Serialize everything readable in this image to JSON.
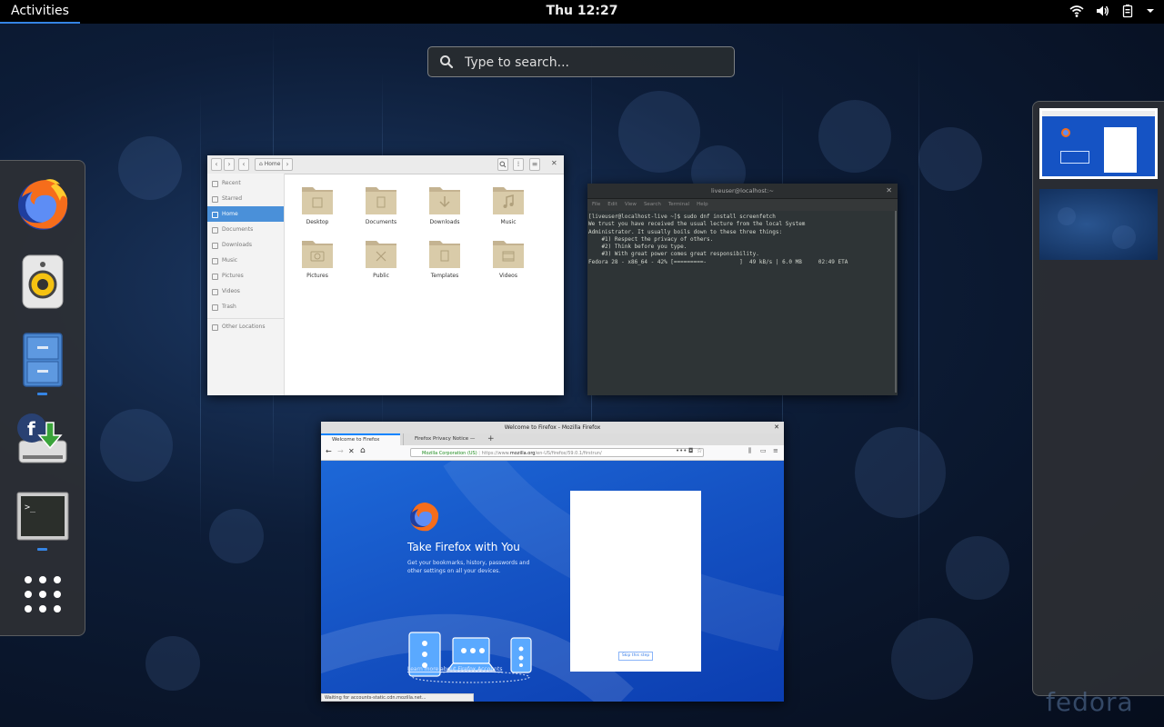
{
  "topbar": {
    "activities": "Activities",
    "clock": "Thu 12:27",
    "icons": [
      "wifi-icon",
      "volume-icon",
      "battery-icon",
      "power-menu-chevron-icon"
    ]
  },
  "search": {
    "placeholder": "Type to search..."
  },
  "dash": {
    "apps": [
      {
        "name": "Firefox",
        "icon": "firefox-icon",
        "running": false
      },
      {
        "name": "Rhythmbox",
        "icon": "speaker-icon",
        "running": false
      },
      {
        "name": "Files",
        "icon": "file-cabinet-icon",
        "running": true
      },
      {
        "name": "Install to Hard Drive",
        "icon": "fedora-install-icon",
        "running": false
      },
      {
        "name": "Terminal",
        "icon": "terminal-icon",
        "running": true
      },
      {
        "name": "Show Applications",
        "icon": "app-grid-icon",
        "running": false
      }
    ]
  },
  "files_window": {
    "path": "Home",
    "sidebar": [
      "Recent",
      "Starred",
      "Home",
      "Documents",
      "Downloads",
      "Music",
      "Pictures",
      "Videos",
      "Trash",
      "Other Locations"
    ],
    "selected_sidebar": "Home",
    "folders": [
      "Desktop",
      "Documents",
      "Downloads",
      "Music",
      "Pictures",
      "Public",
      "Templates",
      "Videos"
    ]
  },
  "terminal_window": {
    "title": "liveuser@localhost:~",
    "menu": [
      "File",
      "Edit",
      "View",
      "Search",
      "Terminal",
      "Help"
    ],
    "lines": [
      "[liveuser@localhost-live ~]$ sudo dnf install screenfetch",
      "",
      "We trust you have received the usual lecture from the local System",
      "Administrator. It usually boils down to these three things:",
      "",
      "    #1) Respect the privacy of others.",
      "    #2) Think before you type.",
      "    #3) With great power comes great responsibility.",
      "",
      "Fedora 28 - x86_64 - 42% [=========-          ]  49 kB/s | 6.0 MB     02:49 ETA"
    ]
  },
  "firefox_window": {
    "title": "Welcome to Firefox - Mozilla Firefox",
    "tabs": [
      "Welcome to Firefox",
      "Firefox Privacy Notice —"
    ],
    "url_org": "Mozilla Corporation (US)",
    "url_prefix": "https://www.",
    "url_domain": "mozilla.org",
    "url_path": "/en-US/firefox/59.0.1/firstrun/",
    "heading": "Take Firefox with You",
    "paragraph": "Get your bookmarks, history, passwords and other settings on all your devices.",
    "link": "Learn more about Firefox Accounts",
    "skip": "Skip this step",
    "status": "Waiting for accounts-static.cdn.mozilla.net..."
  },
  "watermark": "fedora",
  "colors": {
    "accent": "#3584e4",
    "firefox_blue": "#1553c4"
  }
}
